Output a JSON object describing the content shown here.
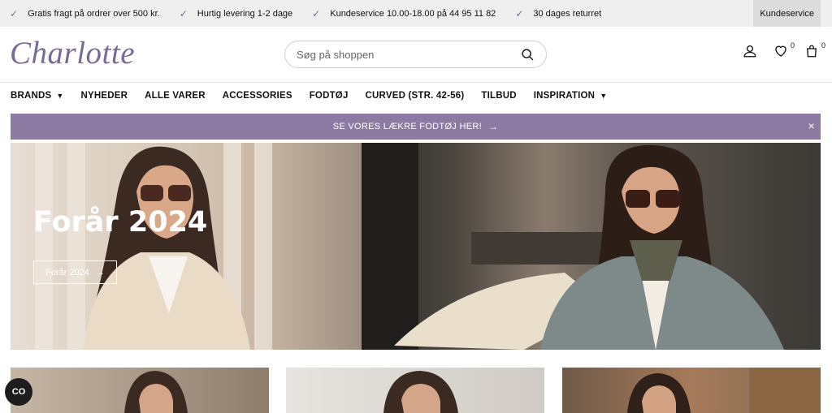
{
  "usp": [
    {
      "text": "Gratis fragt på ordrer over 500 kr.",
      "icon": "check-icon"
    },
    {
      "text": "Hurtig levering 1-2 dage",
      "icon": "check-icon"
    },
    {
      "text": "Kundeservice 10.00-18.00 på 44 95 11 82",
      "icon": "check-icon"
    },
    {
      "text": "30 dages returret",
      "icon": "check-icon"
    }
  ],
  "kundeservice_label": "Kundeservice",
  "logo": "Charlotte",
  "search": {
    "placeholder": "Søg på shoppen"
  },
  "wishlist_count": "0",
  "cart_count": "0",
  "nav": [
    {
      "label": "BRANDS",
      "dropdown": true
    },
    {
      "label": "NYHEDER",
      "dropdown": false
    },
    {
      "label": "ALLE VARER",
      "dropdown": false
    },
    {
      "label": "ACCESSORIES",
      "dropdown": false
    },
    {
      "label": "FODTØJ",
      "dropdown": false
    },
    {
      "label": "CURVED (STR. 42-56)",
      "dropdown": false
    },
    {
      "label": "TILBUD",
      "dropdown": false
    },
    {
      "label": "INSPIRATION",
      "dropdown": true
    }
  ],
  "promo": {
    "text": "SE VORES LÆKRE FODTØJ HER!",
    "arrow": "→",
    "close": "×"
  },
  "hero": {
    "title": "Forår 2024",
    "button": "Forår 2024",
    "arrow": "→"
  },
  "badge": "CO",
  "colors": {
    "brand": "#7a6a97",
    "promo_bg": "#8c7aa3",
    "usp_bg": "#efefef"
  }
}
